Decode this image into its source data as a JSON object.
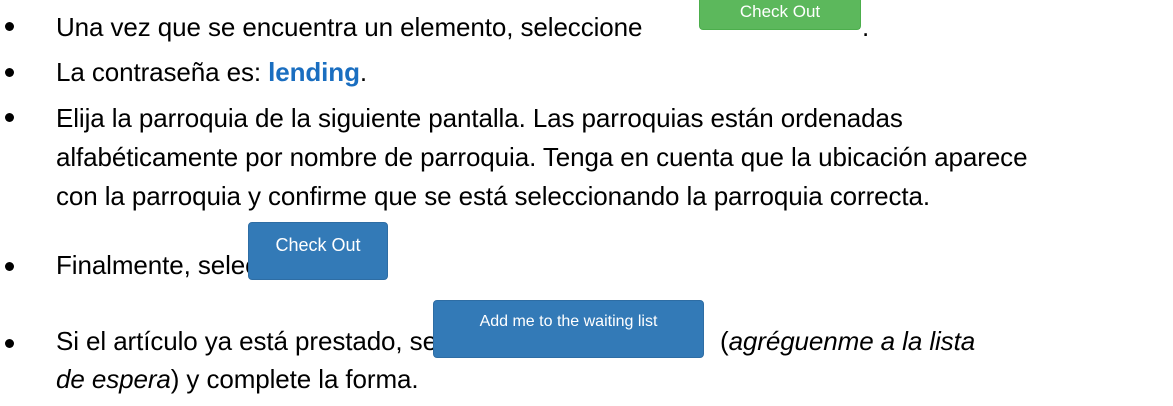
{
  "lines": {
    "item1_text": "Una vez que se encuentra un elemento, seleccione",
    "item1_after": ".",
    "item2_before": "La contraseña es: ",
    "item2_password": "lending",
    "item2_after": ".",
    "item3_line1": "Elija la parroquia de la siguiente pantalla. Las parroquias están ordenadas",
    "item3_line2": "alfabéticamente por nombre de parroquia. Tenga en cuenta que la ubicación aparece",
    "item3_line3": "con la parroquia y confirme que se está seleccionando la parroquia correcta.",
    "item4_text": "Finalmente, seleccione",
    "item5_before": "Si el artículo ya está prestado, seleccione",
    "item5_paren_open": "(",
    "item5_italic_line1": "agréguenme a la lista",
    "item5_italic_line2": "de espera",
    "item5_after": ") y complete la forma."
  },
  "buttons": {
    "check_out_green": "Check Out",
    "check_out_blue": "Check Out",
    "waiting_list": "Add me to the waiting list"
  },
  "colors": {
    "password": "#1a6ec0",
    "green_button": "#5cb85c",
    "blue_button": "#337ab7"
  }
}
